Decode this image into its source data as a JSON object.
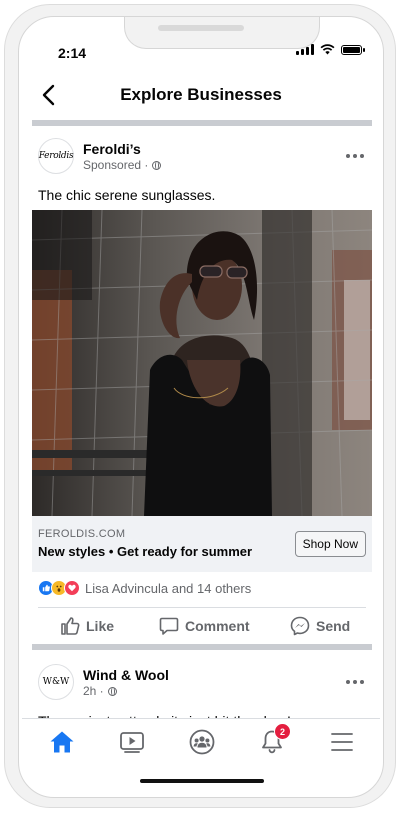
{
  "status": {
    "time": "2:14"
  },
  "header": {
    "title": "Explore Businesses"
  },
  "post1": {
    "business": "Feroldi’s",
    "logo_text": "Feroldis",
    "meta": "Sponsored ·",
    "caption": "The chic serene sunglasses.",
    "link": {
      "domain": "FEROLDIS.COM",
      "headline": "New styles • Get ready for summer",
      "cta": "Shop Now"
    },
    "reactions_text": "Lisa Advincula and 14 others",
    "actions": {
      "like": "Like",
      "comment": "Comment",
      "send": "Send"
    }
  },
  "post2": {
    "business": "Wind & Wool",
    "logo_text": "W&W",
    "meta": "2h ·",
    "caption_peek": "The easiest cotton knits just hit the shop!"
  },
  "nav": {
    "notification_count": "2"
  },
  "colors": {
    "accent": "#1877f2",
    "badge": "#e41e3f",
    "divider": "#c9ccd1"
  }
}
